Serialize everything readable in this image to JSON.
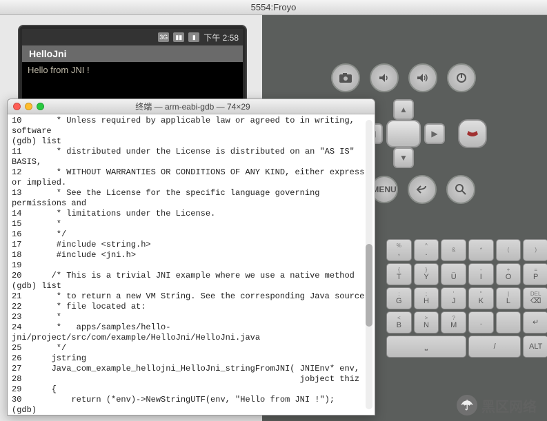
{
  "parent_window_title": "5554:Froyo",
  "phone": {
    "status": {
      "net_icon_label": "3G",
      "signal_icon": "signal-icon",
      "clock": "下午 2:58"
    },
    "app_title": "HelloJni",
    "app_text": "Hello from JNI !"
  },
  "terminal": {
    "title": "终端 — arm-eabi-gdb — 74×29",
    "lines": [
      "10       * Unless required by applicable law or agreed to in writing, software",
      "(gdb) list",
      "11       * distributed under the License is distributed on an \"AS IS\" BASIS,",
      "12       * WITHOUT WARRANTIES OR CONDITIONS OF ANY KIND, either express or implied.",
      "13       * See the License for the specific language governing permissions and",
      "14       * limitations under the License.",
      "15       *",
      "16       */",
      "17       #include <string.h>",
      "18       #include <jni.h>",
      "19",
      "20      /* This is a trivial JNI example where we use a native method",
      "(gdb) list",
      "21       * to return a new VM String. See the corresponding Java source",
      "22       * file located at:",
      "23       *",
      "24       *   apps/samples/hello-jni/project/src/com/example/HelloJni/HelloJni.java",
      "25       */",
      "26      jstring",
      "27      Java_com_example_hellojni_HelloJni_stringFromJNI( JNIEnv* env,",
      "28                                                        jobject thiz )",
      "29      {",
      "30          return (*env)->NewStringUTF(env, \"Hello from JNI !\");",
      "(gdb) "
    ]
  },
  "hw_buttons": {
    "camera": "camera-icon",
    "vol_down": "volume-down-icon",
    "vol_up": "volume-up-icon",
    "power": "power-icon",
    "call": "call-icon",
    "home": "home-icon",
    "end": "end-call-icon",
    "menu_label": "MENU",
    "back": "back-icon",
    "search": "search-icon"
  },
  "keyboard": {
    "rows": [
      [
        {
          "sup": "%",
          "main": ","
        },
        {
          "sup": "^",
          "main": "."
        },
        {
          "sup": "&",
          "main": ""
        },
        {
          "sup": "*",
          "main": ""
        },
        {
          "sup": "(",
          "main": ""
        },
        {
          "sup": ")",
          "main": ""
        }
      ],
      [
        {
          "sup": "{",
          "main": "T"
        },
        {
          "sup": "}",
          "main": "Y"
        },
        {
          "sup": "_",
          "main": "U"
        },
        {
          "sup": "-",
          "main": "I"
        },
        {
          "sup": "+",
          "main": "O"
        },
        {
          "sup": "=",
          "main": "P"
        }
      ],
      [
        {
          "sup": ":",
          "main": "G"
        },
        {
          "sup": ";",
          "main": "H"
        },
        {
          "sup": "'",
          "main": "J"
        },
        {
          "sup": "\"",
          "main": "K"
        },
        {
          "sup": "|",
          "main": "L"
        },
        {
          "sup": "DEL",
          "main": "⌫"
        }
      ],
      [
        {
          "sup": "<",
          "main": "B"
        },
        {
          "sup": ">",
          "main": "N"
        },
        {
          "sup": "?",
          "main": "M"
        },
        {
          "sup": "",
          "main": "."
        },
        {
          "sup": "",
          "main": ""
        },
        {
          "sup": "",
          "main": "↵"
        }
      ],
      [
        {
          "sup": "",
          "main": "⎵",
          "wide": true
        },
        {
          "sup": "",
          "main": "/",
          "double": true
        },
        {
          "sup": "",
          "main": "ALT"
        }
      ]
    ]
  },
  "watermark_text": "黑区网络"
}
